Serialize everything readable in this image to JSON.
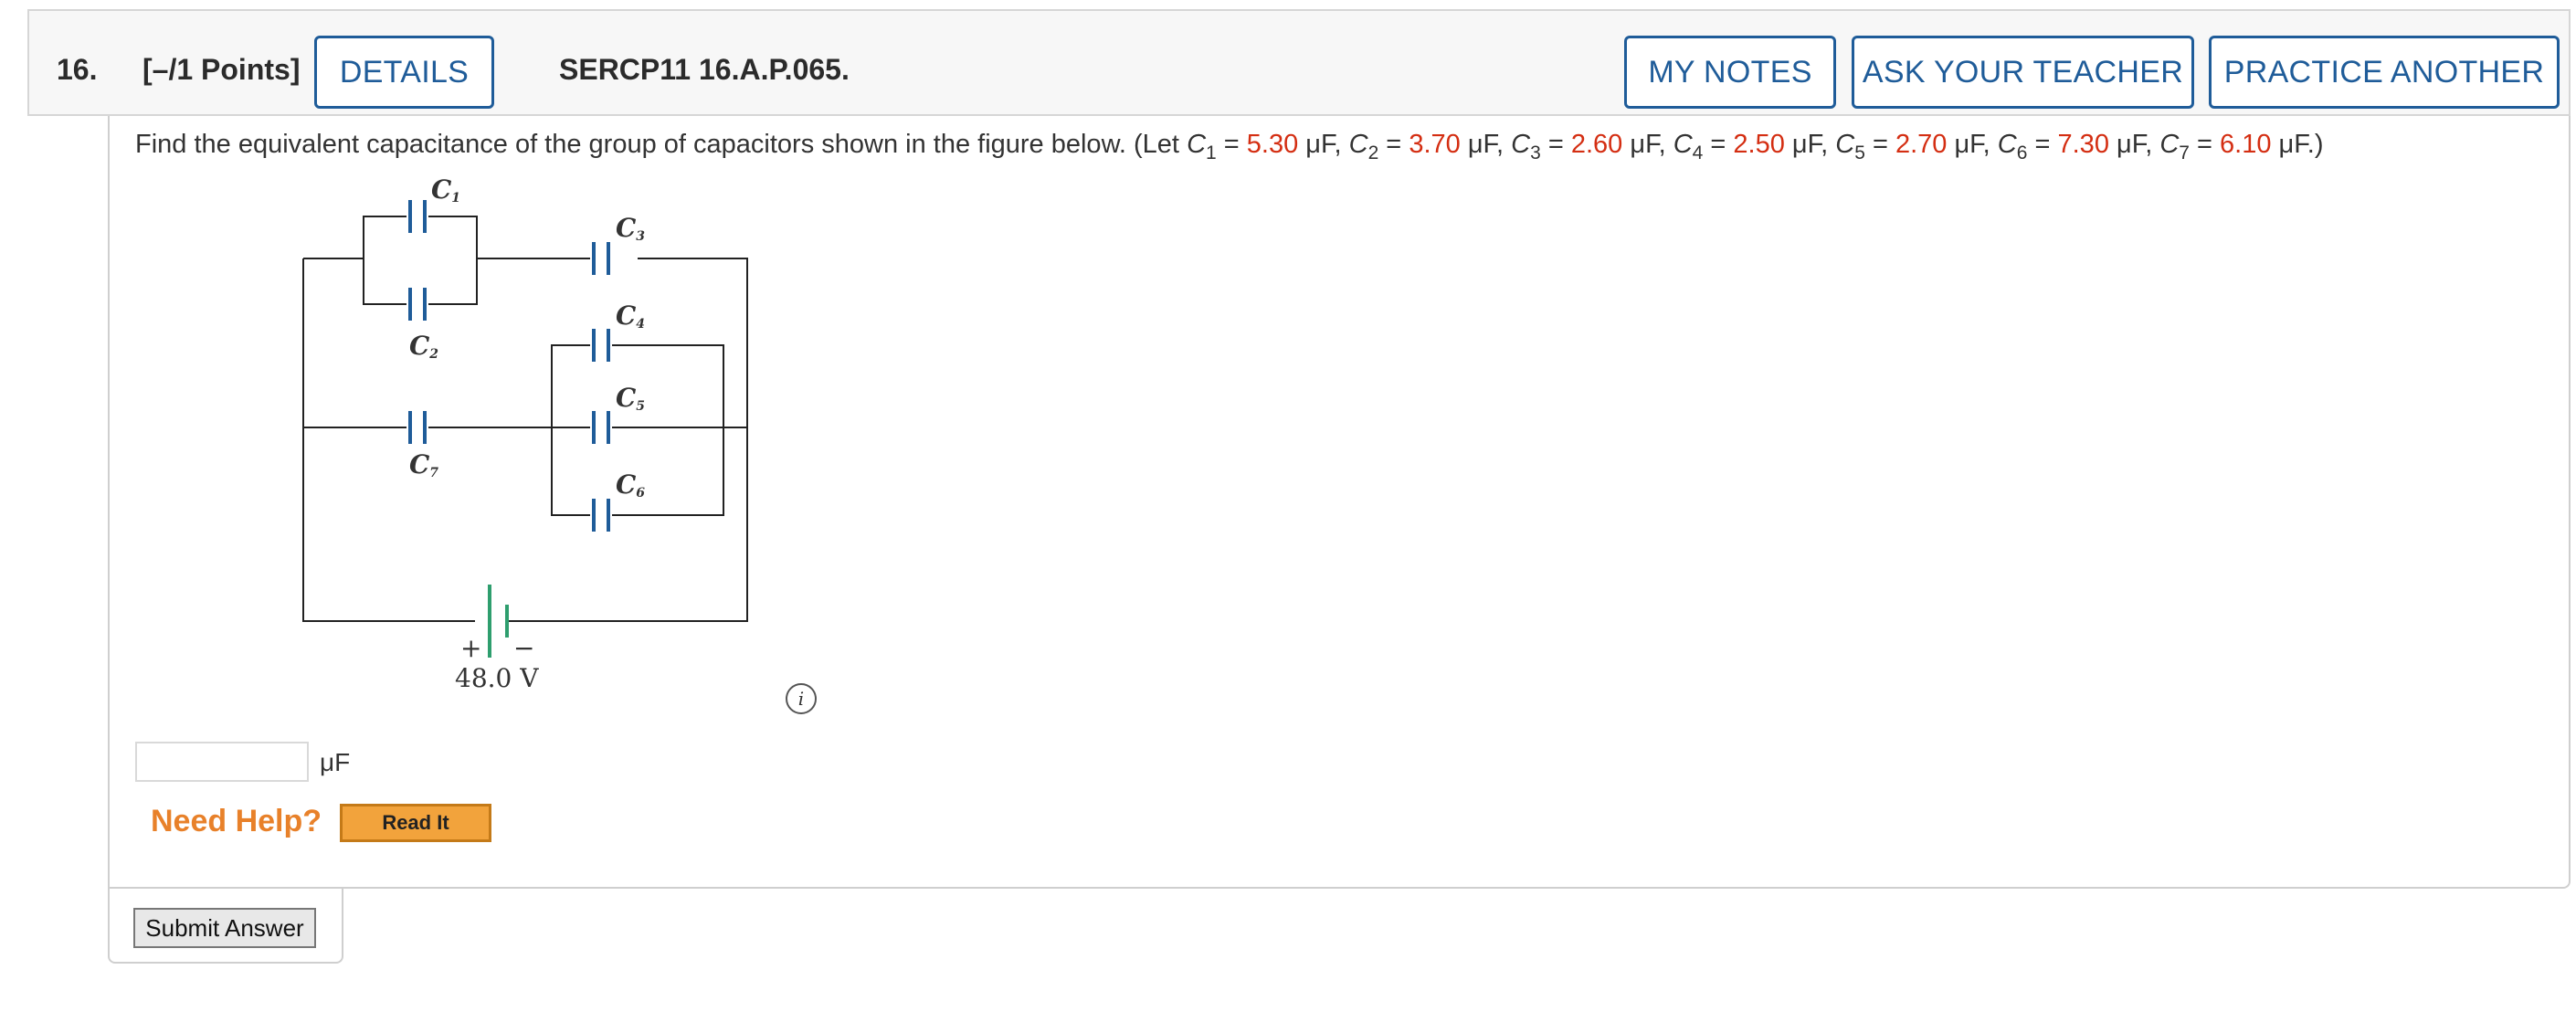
{
  "header": {
    "question_number": "16.",
    "points": "[–/1 Points]",
    "details_label": "DETAILS",
    "problem_code": "SERCP11 16.A.P.065.",
    "my_notes_label": "MY NOTES",
    "ask_teacher_label": "ASK YOUR TEACHER",
    "practice_another_label": "PRACTICE ANOTHER"
  },
  "prompt": {
    "intro": "Find the equivalent capacitance of the group of capacitors shown in the figure below. (Let ",
    "eq": " = ",
    "unit_sep": " μF, ",
    "unit_end": " μF.)",
    "C": "C",
    "values": [
      "5.30",
      "3.70",
      "2.60",
      "2.50",
      "2.70",
      "7.30",
      "6.10"
    ],
    "subs": [
      "1",
      "2",
      "3",
      "4",
      "5",
      "6",
      "7"
    ]
  },
  "figure": {
    "labels": {
      "c1": "C",
      "c2": "C",
      "c3": "C",
      "c4": "C",
      "c5": "C",
      "c6": "C",
      "c7": "C"
    },
    "subs": {
      "c1": "1",
      "c2": "2",
      "c3": "3",
      "c4": "4",
      "c5": "5",
      "c6": "6",
      "c7": "7"
    },
    "plus": "+",
    "minus": "−",
    "voltage": "48.0 V",
    "colors": {
      "wire": "#222222",
      "capacitor": "#1f5c99",
      "battery": "#2e9e6e"
    }
  },
  "info_icon": "i",
  "answer": {
    "value": "",
    "unit": "μF"
  },
  "help": {
    "need_help": "Need Help?",
    "read_it": "Read It"
  },
  "submit_label": "Submit Answer"
}
